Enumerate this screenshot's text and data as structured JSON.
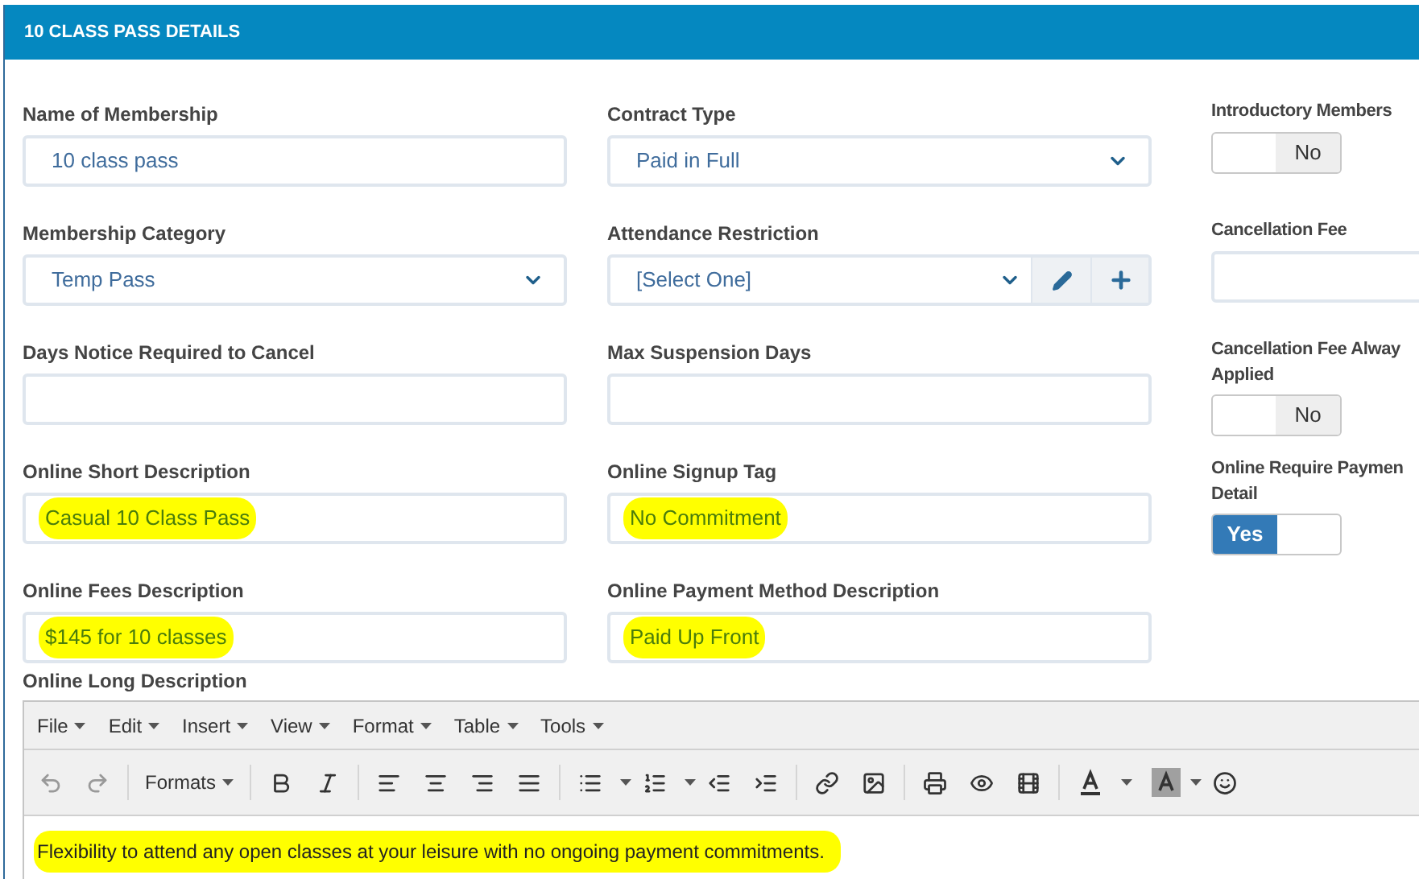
{
  "panel": {
    "title": "10 CLASS PASS DETAILS"
  },
  "rows": [
    [
      {
        "label_lines": [
          "Name of Membership"
        ],
        "kind": "text",
        "value": "10 class pass"
      },
      {
        "label_lines": [
          "Contract Type"
        ],
        "kind": "select",
        "value": "Paid in Full"
      },
      {
        "label_lines": [
          "Introductory Members"
        ],
        "kind": "toggle",
        "on": false,
        "off_label": "No"
      }
    ],
    [
      {
        "label_lines": [
          "Membership Category"
        ],
        "kind": "select",
        "value": "Temp Pass"
      },
      {
        "label_lines": [
          "Attendance Restriction"
        ],
        "kind": "select_edit",
        "value": "[Select One]"
      },
      {
        "label_lines": [
          "Cancellation Fee"
        ],
        "kind": "text"
      }
    ],
    [
      {
        "label_lines": [
          "Days Notice Required to Cancel"
        ],
        "kind": "text"
      },
      {
        "label_lines": [
          "Max Suspension Days"
        ],
        "kind": "text"
      },
      {
        "label_lines": [
          "Cancellation Fee Alway",
          "Applied"
        ],
        "kind": "toggle",
        "on": false,
        "off_label": "No"
      }
    ],
    [
      {
        "label_lines": [
          "Online Short Description"
        ],
        "kind": "text",
        "value": "Casual 10 Class Pass",
        "highlighted": true
      },
      {
        "label_lines": [
          "Online Signup Tag"
        ],
        "kind": "text",
        "value": "No Commitment",
        "highlighted": true
      },
      {
        "label_lines": [
          "Online Require Paymen",
          "Detail"
        ],
        "kind": "toggle",
        "on": true,
        "on_label": "Yes"
      }
    ],
    [
      {
        "label_lines": [
          "Online Fees Description"
        ],
        "kind": "text",
        "value": "$145 for 10 classes",
        "highlighted": true
      },
      {
        "label_lines": [
          "Online Payment Method Description"
        ],
        "kind": "text",
        "value": "Paid Up Front",
        "highlighted": true
      }
    ]
  ],
  "editor": {
    "label": "Online Long Description",
    "menus": [
      "File",
      "Edit",
      "Insert",
      "View",
      "Format",
      "Table",
      "Tools"
    ],
    "formats_label": "Formats",
    "content": "Flexibility to attend any open classes at your leisure with no ongoing payment commitments.",
    "highlighted": true
  }
}
